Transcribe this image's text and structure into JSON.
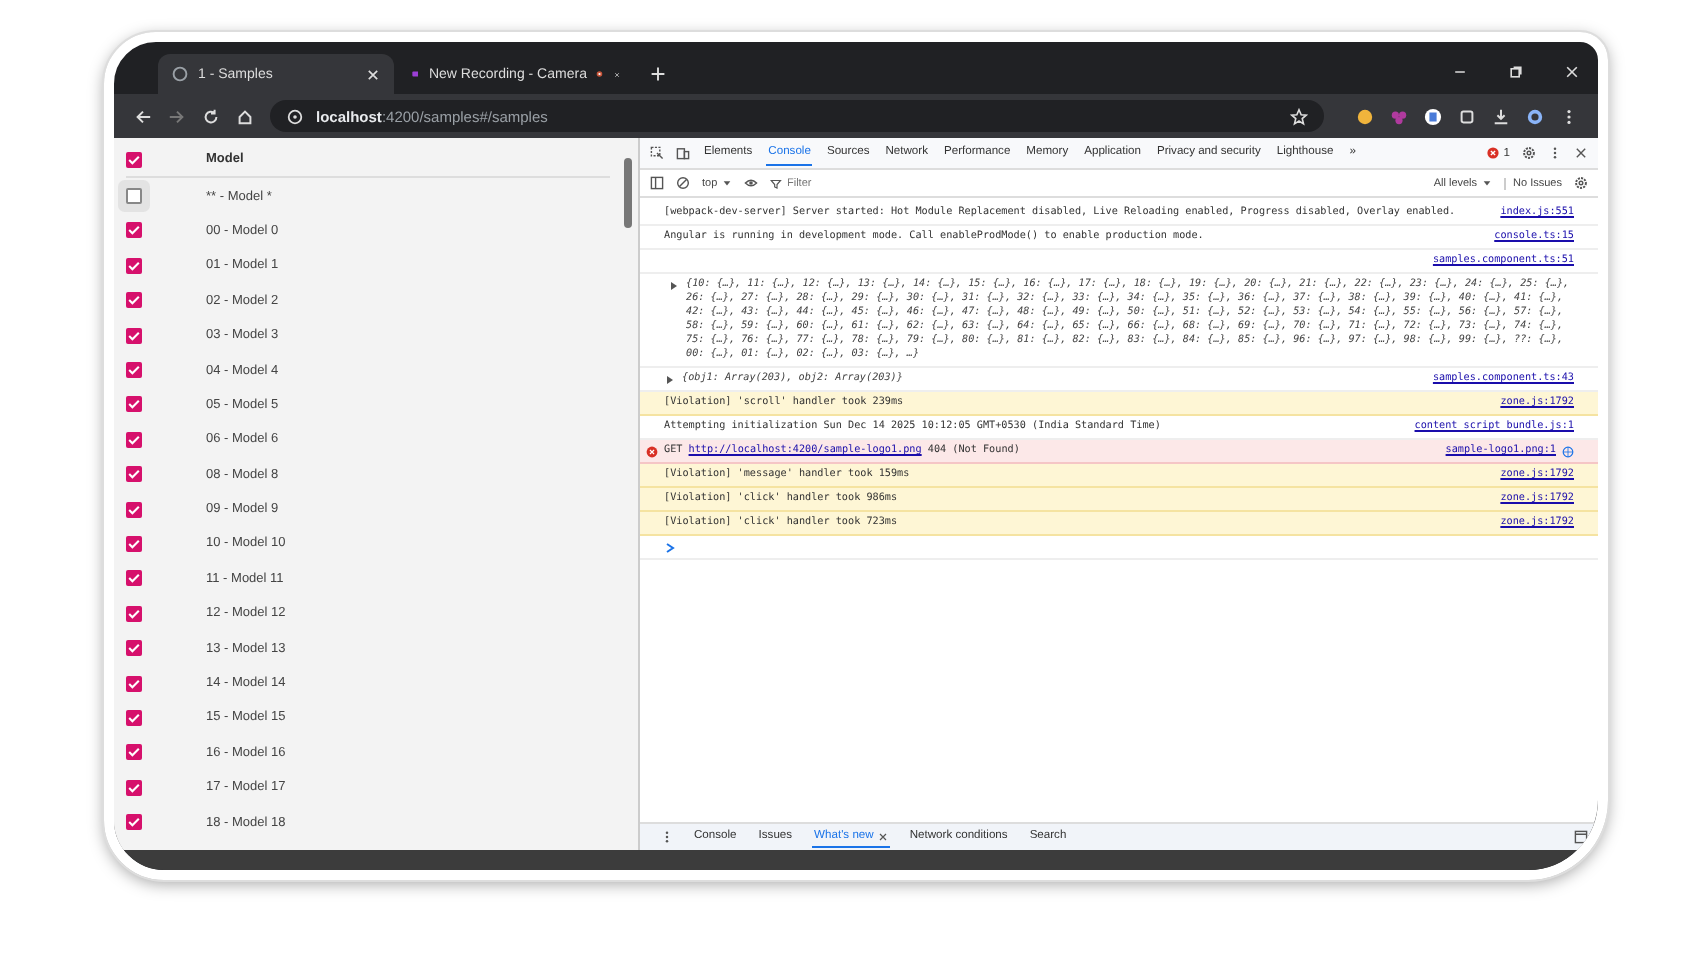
{
  "browser": {
    "tabs": [
      {
        "title": "1 - Samples",
        "selected": true,
        "kind": "page"
      },
      {
        "title": "New Recording - Camera",
        "selected": false,
        "kind": "recording"
      }
    ],
    "url_host": "localhost",
    "url_path": ":4200/samples#/samples"
  },
  "app": {
    "header": "Model",
    "header_checked": true,
    "rows": [
      {
        "label": "** - Model *",
        "checked": false
      },
      {
        "label": "00 - Model 0",
        "checked": true
      },
      {
        "label": "01 - Model 1",
        "checked": true
      },
      {
        "label": "02 - Model 2",
        "checked": true
      },
      {
        "label": "03 - Model 3",
        "checked": true
      },
      {
        "label": "04 - Model 4",
        "checked": true
      },
      {
        "label": "05 - Model 5",
        "checked": true
      },
      {
        "label": "06 - Model 6",
        "checked": true
      },
      {
        "label": "08 - Model 8",
        "checked": true
      },
      {
        "label": "09 - Model 9",
        "checked": true
      },
      {
        "label": "10 - Model 10",
        "checked": true
      },
      {
        "label": "11 - Model 11",
        "checked": true
      },
      {
        "label": "12 - Model 12",
        "checked": true
      },
      {
        "label": "13 - Model 13",
        "checked": true
      },
      {
        "label": "14 - Model 14",
        "checked": true
      },
      {
        "label": "15 - Model 15",
        "checked": true
      },
      {
        "label": "16 - Model 16",
        "checked": true
      },
      {
        "label": "17 - Model 17",
        "checked": true
      },
      {
        "label": "18 - Model 18",
        "checked": true
      }
    ]
  },
  "devtools": {
    "tabs": [
      {
        "label": "Elements",
        "selected": false
      },
      {
        "label": "Console",
        "selected": true
      },
      {
        "label": "Sources",
        "selected": false
      },
      {
        "label": "Network",
        "selected": false
      },
      {
        "label": "Performance",
        "selected": false
      },
      {
        "label": "Memory",
        "selected": false
      },
      {
        "label": "Application",
        "selected": false
      },
      {
        "label": "Privacy and security",
        "selected": false
      },
      {
        "label": "Lighthouse",
        "selected": false
      }
    ],
    "overflow": "»",
    "error_count": "1",
    "context": "top",
    "filter_placeholder": "Filter",
    "levels": "All levels",
    "issues": "No Issues",
    "messages": [
      {
        "kind": "log",
        "text": "[webpack-dev-server] Server started: Hot Module Replacement disabled, Live Reloading enabled, Progress disabled, Overlay enabled.",
        "source": "index.js:551"
      },
      {
        "kind": "log",
        "text": "Angular is running in development mode. Call enableProdMode() to enable production mode.",
        "source": "console.ts:15"
      },
      {
        "kind": "object_block",
        "text": "{10: {…}, 11: {…}, 12: {…}, 13: {…}, 14: {…}, 15: {…}, 16: {…}, 17: {…}, 18: {…}, 19: {…}, 20: {…}, 21: {…}, 22: {…}, 23: {…}, 24: {…}, 25: {…}, 26: {…}, 27: {…}, 28: {…}, 29: {…}, 30: {…}, 31: {…}, 32: {…}, 33: {…}, 34: {…}, 35: {…}, 36: {…}, 37: {…}, 38: {…}, 39: {…}, 40: {…}, 41: {…}, 42: {…}, 43: {…}, 44: {…}, 45: {…}, 46: {…}, 47: {…}, 48: {…}, 49: {…}, 50: {…}, 51: {…}, 52: {…}, 53: {…}, 54: {…}, 55: {…}, 56: {…}, 57: {…}, 58: {…}, 59: {…}, 60: {…}, 61: {…}, 62: {…}, 63: {…}, 64: {…}, 65: {…}, 66: {…}, 68: {…}, 69: {…}, 70: {…}, 71: {…}, 72: {…}, 73: {…}, 74: {…}, 75: {…}, 76: {…}, 77: {…}, 78: {…}, 79: {…}, 80: {…}, 81: {…}, 82: {…}, 83: {…}, 84: {…}, 85: {…}, 96: {…}, 97: {…}, 98: {…}, 99: {…}, ??: {…}, 00: {…}, 01: {…}, 02: {…}, 03: {…}, …}",
        "source": "samples.component.ts:51"
      },
      {
        "kind": "object",
        "text": "{obj1: Array(203), obj2: Array(203)}",
        "source": "samples.component.ts:43"
      },
      {
        "kind": "violation",
        "text": "[Violation] 'scroll' handler took 239ms",
        "source": "zone.js:1792"
      },
      {
        "kind": "log",
        "text": "Attempting initialization Sun Dec 14 2025 10:12:05 GMT+0530 (India Standard Time)",
        "source": "content_script_bundle.js:1"
      },
      {
        "kind": "error",
        "method": "GET",
        "url": "http://localhost:4200/sample-logo1.png",
        "status": "404 (Not Found)",
        "source": "sample-logo1.png:1"
      },
      {
        "kind": "violation",
        "text": "[Violation] 'message' handler took 159ms",
        "source": "zone.js:1792"
      },
      {
        "kind": "violation",
        "text": "[Violation] 'click' handler took 986ms",
        "source": "zone.js:1792"
      },
      {
        "kind": "violation",
        "text": "[Violation] 'click' handler took 723ms",
        "source": "zone.js:1792"
      }
    ],
    "drawer_tabs": [
      {
        "label": "Console",
        "selected": false,
        "closable": false
      },
      {
        "label": "Issues",
        "selected": false,
        "closable": false
      },
      {
        "label": "What's new",
        "selected": true,
        "closable": true
      },
      {
        "label": "Network conditions",
        "selected": false,
        "closable": false
      },
      {
        "label": "Search",
        "selected": false,
        "closable": false
      }
    ]
  }
}
